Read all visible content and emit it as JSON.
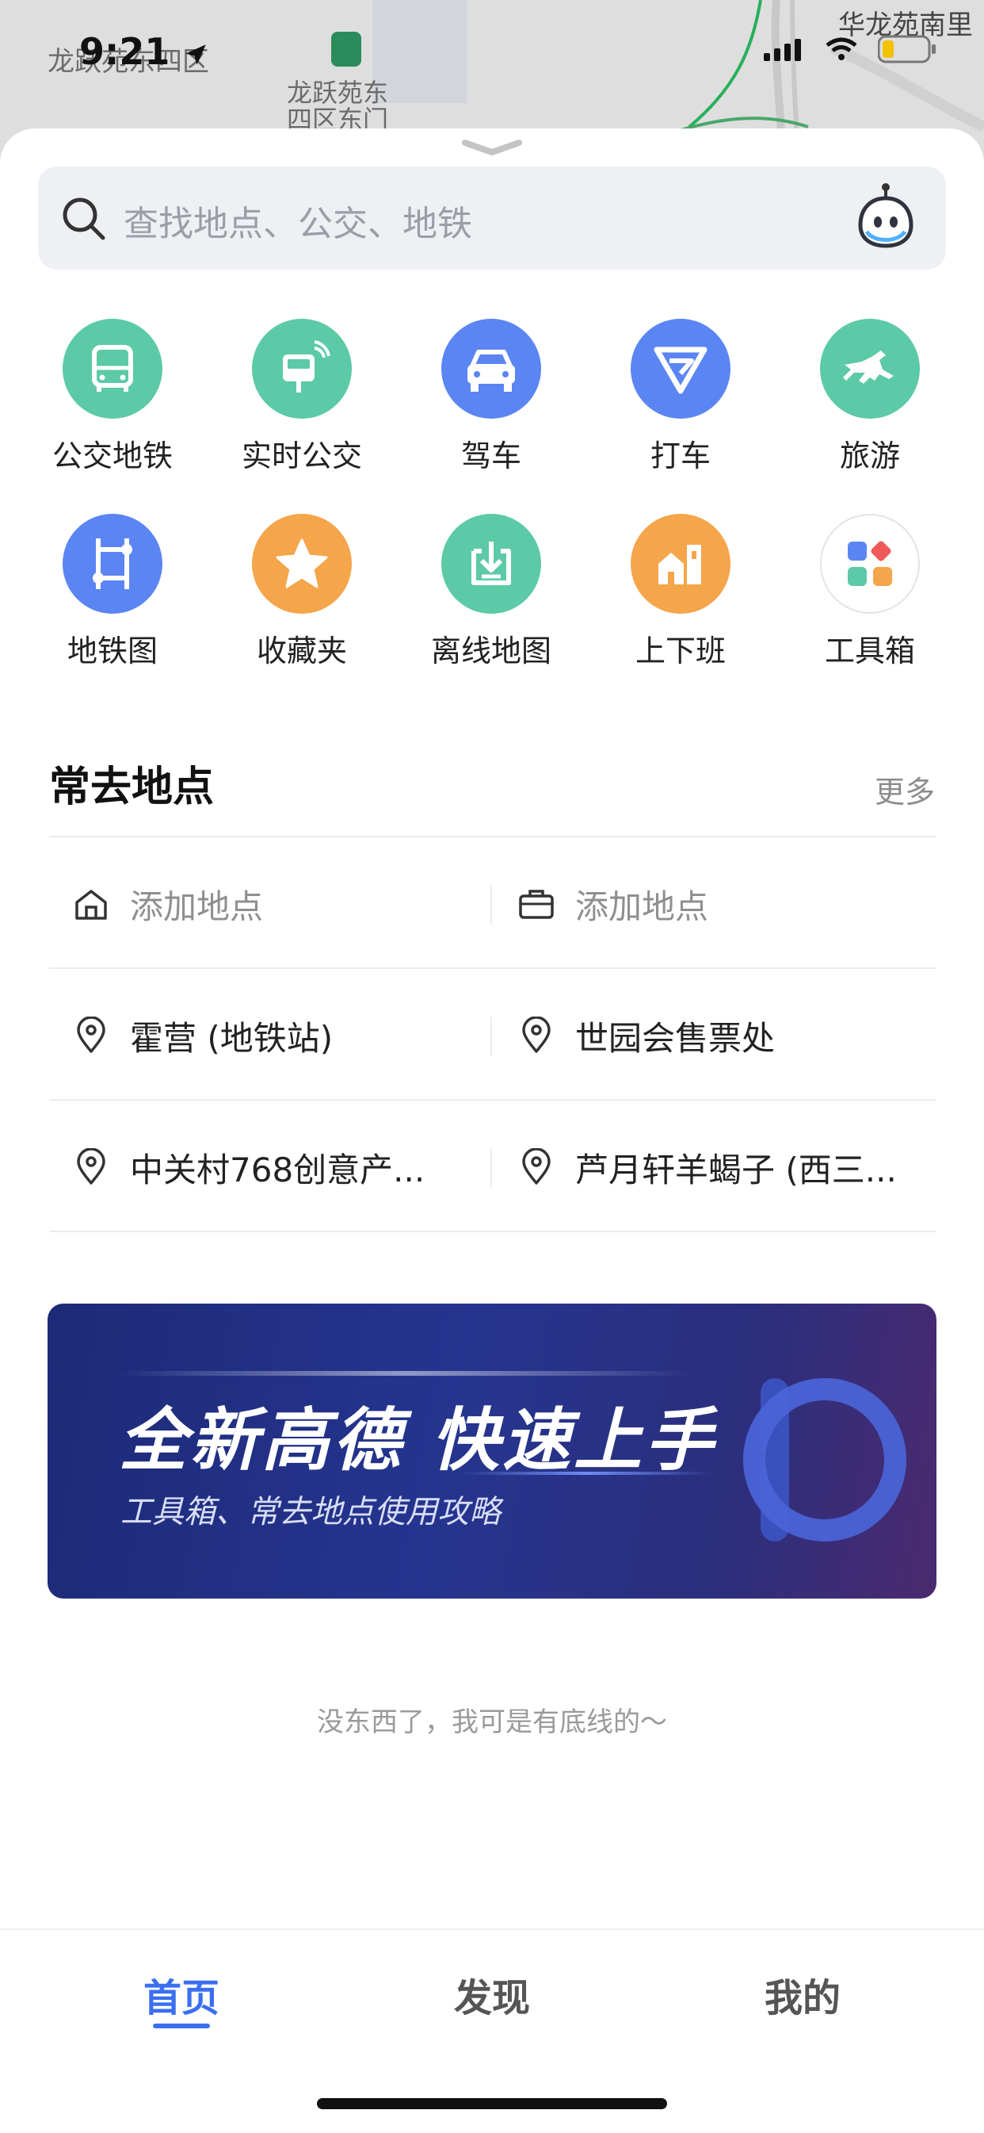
{
  "status_bar": {
    "time": "9:21"
  },
  "map": {
    "labels": [
      "龙跃苑东四区",
      "龙跃苑东四区东门",
      "华龙苑南里"
    ]
  },
  "search": {
    "placeholder": "查找地点、公交、地铁"
  },
  "quick_actions": [
    {
      "label": "公交地铁",
      "icon": "bus-icon",
      "color": "#5cc9a7"
    },
    {
      "label": "实时公交",
      "icon": "realtime-bus-icon",
      "color": "#5cc9a7"
    },
    {
      "label": "驾车",
      "icon": "car-icon",
      "color": "#5b85f3"
    },
    {
      "label": "打车",
      "icon": "taxi-icon",
      "color": "#5b85f3"
    },
    {
      "label": "旅游",
      "icon": "horse-icon",
      "color": "#5cc9a7"
    },
    {
      "label": "地铁图",
      "icon": "subway-map-icon",
      "color": "#5b85f3"
    },
    {
      "label": "收藏夹",
      "icon": "star-icon",
      "color": "#f5a54a"
    },
    {
      "label": "离线地图",
      "icon": "download-icon",
      "color": "#5cc9a7"
    },
    {
      "label": "上下班",
      "icon": "commute-home-icon",
      "color": "#f5a54a"
    },
    {
      "label": "工具箱",
      "icon": "toolbox-icon",
      "color": "#ffffff"
    }
  ],
  "frequent_places": {
    "title": "常去地点",
    "more": "更多",
    "rows": [
      [
        "添加地点",
        "添加地点"
      ],
      [
        "霍营 (地铁站)",
        "世园会售票处"
      ],
      [
        "中关村768创意产...",
        "芦月轩羊蝎子 (西三..."
      ]
    ]
  },
  "banner": {
    "title": "全新高德  快速上手",
    "subtitle": "工具箱、常去地点使用攻略"
  },
  "footer_note": "没东西了，我可是有底线的～",
  "tabs": [
    {
      "label": "首页",
      "active": true
    },
    {
      "label": "发现",
      "active": false
    },
    {
      "label": "我的",
      "active": false
    }
  ]
}
